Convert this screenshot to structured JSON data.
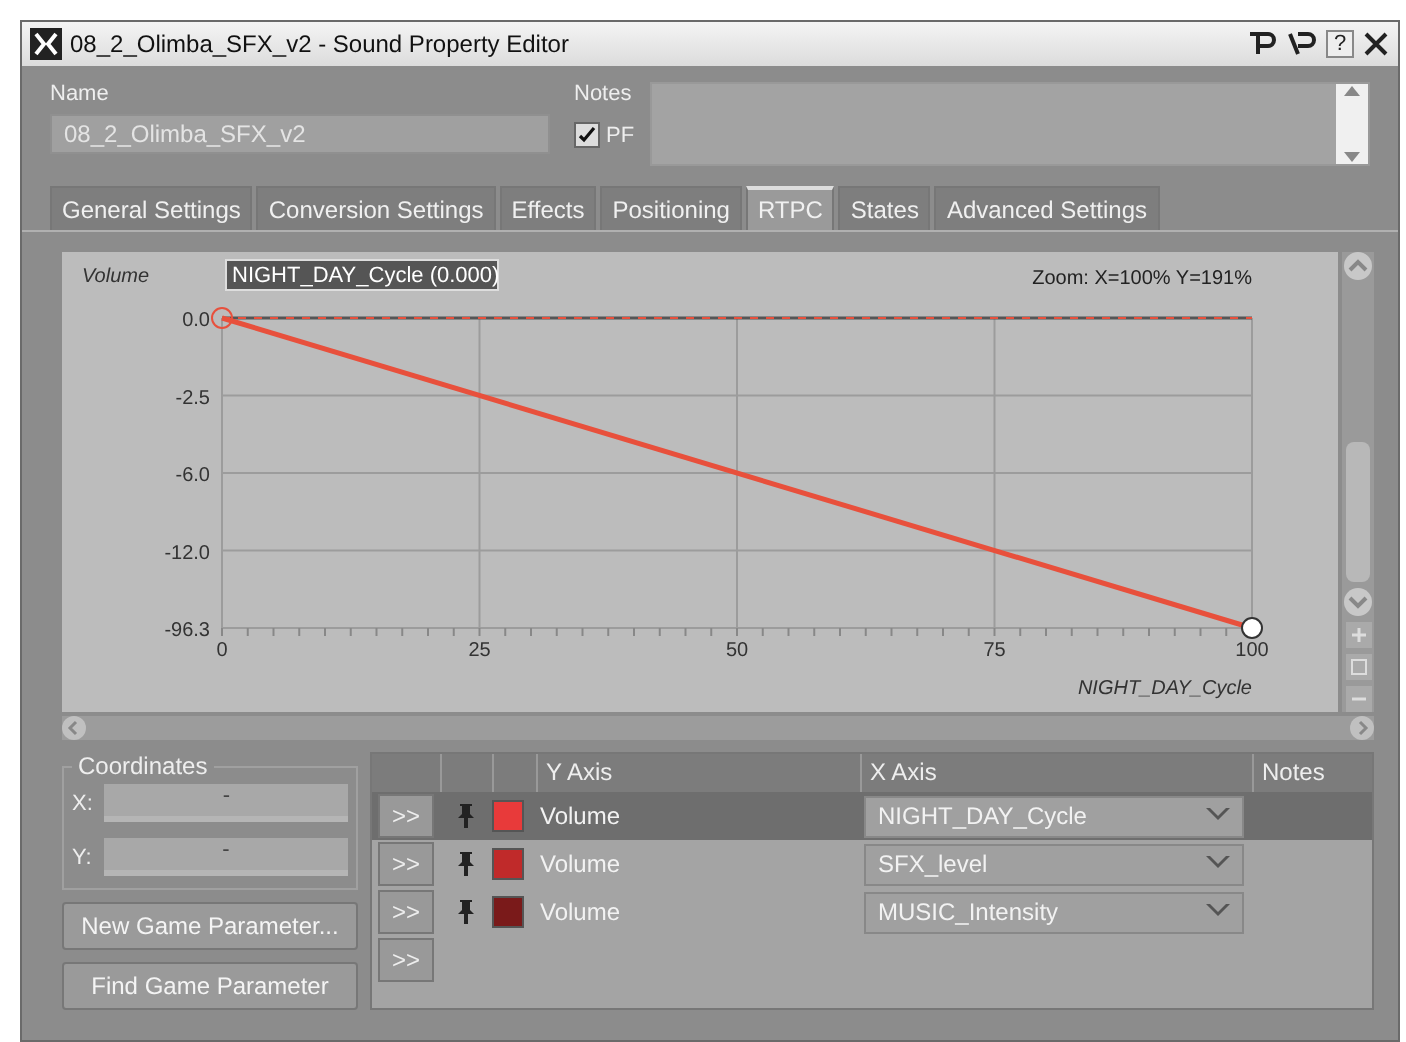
{
  "window": {
    "title": "08_2_Olimba_SFX_v2 - Sound Property Editor",
    "help": "?"
  },
  "name": {
    "label": "Name",
    "value": "08_2_Olimba_SFX_v2"
  },
  "notes": {
    "label": "Notes"
  },
  "pf": {
    "label": "PF",
    "checked": true
  },
  "tabs": [
    {
      "label": "General Settings",
      "selected": false
    },
    {
      "label": "Conversion Settings",
      "selected": false
    },
    {
      "label": "Effects",
      "selected": false
    },
    {
      "label": "Positioning",
      "selected": false
    },
    {
      "label": "RTPC",
      "selected": true
    },
    {
      "label": "States",
      "selected": false
    },
    {
      "label": "Advanced Settings",
      "selected": false
    }
  ],
  "graph": {
    "curve_label": "NIGHT_DAY_Cycle (0.000)",
    "zoom": "Zoom: X=100% Y=191%",
    "x_axis_label": "NIGHT_DAY_Cycle",
    "y_axis_label": "Volume",
    "x_labels": [
      "0",
      "25",
      "50",
      "75",
      "100"
    ],
    "y_labels": [
      "0.0",
      "-2.5",
      "-6.0",
      "-12.0",
      "-96.3"
    ]
  },
  "coordinates": {
    "title": "Coordinates",
    "x_label": "X:",
    "x_value": "-",
    "y_label": "Y:",
    "y_value": "-"
  },
  "buttons": [
    "New Game Parameter...",
    "Find Game Parameter"
  ],
  "table": {
    "columns": [
      "Y Axis",
      "X Axis",
      "Notes"
    ],
    "rows": [
      {
        "expand": ">>",
        "color": "#e83a3a",
        "y_axis": "Volume",
        "x_axis": "NIGHT_DAY_Cycle",
        "selected": true
      },
      {
        "expand": ">>",
        "color": "#c02a2a",
        "y_axis": "Volume",
        "x_axis": "SFX_level",
        "selected": false
      },
      {
        "expand": ">>",
        "color": "#7a1a1a",
        "y_axis": "Volume",
        "x_axis": "MUSIC_Intensity",
        "selected": false
      }
    ],
    "new_row": ">>"
  }
}
